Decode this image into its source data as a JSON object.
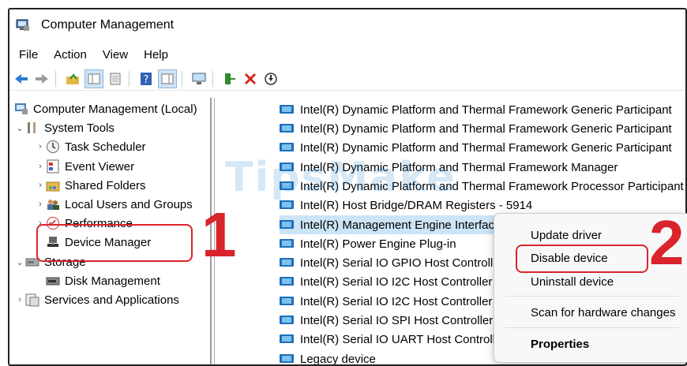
{
  "window": {
    "title": "Computer Management"
  },
  "menu": [
    "File",
    "Action",
    "View",
    "Help"
  ],
  "toolbar": [
    "back-icon",
    "forward-icon",
    "up-folder-icon",
    "show-tree-icon",
    "properties-icon",
    "help-icon",
    "action-pane-icon",
    "console-icon",
    "enable-device-icon",
    "uninstall-icon",
    "scan-icon"
  ],
  "tree": {
    "root": "Computer Management (Local)",
    "system_tools": "System Tools",
    "task_scheduler": "Task Scheduler",
    "event_viewer": "Event Viewer",
    "shared_folders": "Shared Folders",
    "local_users": "Local Users and Groups",
    "performance": "Performance",
    "device_manager": "Device Manager",
    "storage": "Storage",
    "disk_management": "Disk Management",
    "services": "Services and Applications"
  },
  "devices": [
    "Intel(R) Dynamic Platform and Thermal Framework Generic Participant",
    "Intel(R) Dynamic Platform and Thermal Framework Generic Participant",
    "Intel(R) Dynamic Platform and Thermal Framework Generic Participant",
    "Intel(R) Dynamic Platform and Thermal Framework Manager",
    "Intel(R) Dynamic Platform and Thermal Framework Processor Participant",
    "Intel(R) Host Bridge/DRAM Registers - 5914",
    "Intel(R) Management Engine Interface",
    "Intel(R) Power Engine Plug-in",
    "Intel(R) Serial IO GPIO Host Controller",
    "Intel(R) Serial IO I2C Host Controller",
    "Intel(R) Serial IO I2C Host Controller",
    "Intel(R) Serial IO SPI Host Controller",
    "Intel(R) Serial IO UART Host Controller",
    "Legacy device"
  ],
  "context_menu": {
    "update": "Update driver",
    "disable": "Disable device",
    "uninstall": "Uninstall device",
    "scan": "Scan for hardware changes",
    "properties": "Properties"
  },
  "annotations": {
    "step1": "1",
    "step2": "2"
  },
  "watermark": "TipsMake",
  "colors": {
    "callout": "#d9242b",
    "device_icon": "#1f6fb8"
  }
}
